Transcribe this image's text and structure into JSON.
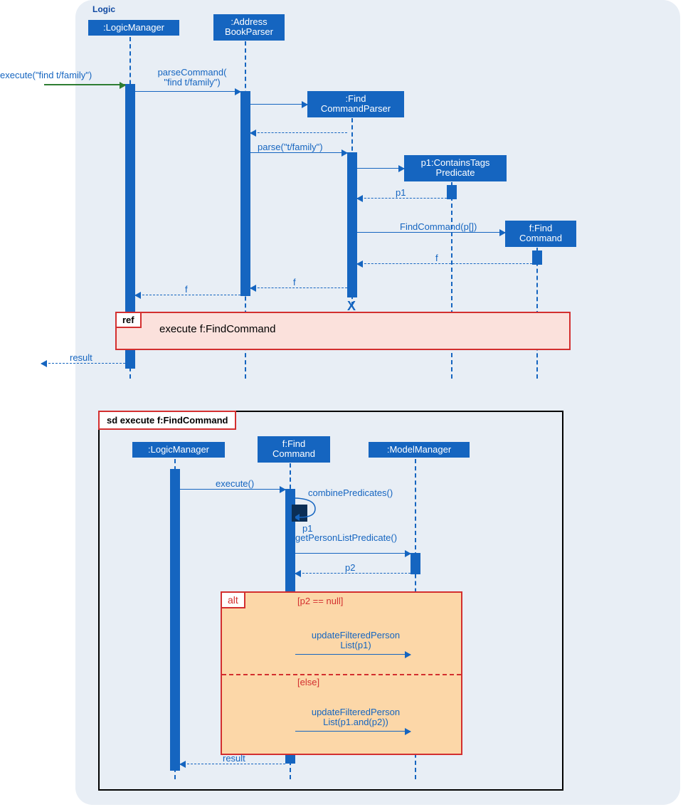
{
  "pkg": "Logic",
  "top": {
    "logicManager": ":LogicManager",
    "addressBookParser": ":Address BookParser",
    "findCommandParser": ":Find CommandParser",
    "containsTagsPredicate": "p1:ContainsTags Predicate",
    "findCommand": "f:Find Command"
  },
  "msgs": {
    "execute": "execute(\"find t/family\")",
    "parseCommand": "parseCommand( \"find t/family\")",
    "parse": "parse(\"t/family\")",
    "p1": "p1",
    "findCommandNew": "FindCommand(p[])",
    "f": "f",
    "result": "result"
  },
  "ref": {
    "tag": "ref",
    "title": "execute f:FindCommand"
  },
  "sd": {
    "title": "sd execute f:FindCommand",
    "logicManager": ":LogicManager",
    "findCommand": "f:Find Command",
    "modelManager": ":ModelManager",
    "execute": "execute()",
    "combinePredicates": "combinePredicates()",
    "p1": "p1",
    "getPersonListPredicate": "getPersonListPredicate()",
    "p2": "p2",
    "alt": "alt",
    "cond1": "[p2 == null]",
    "call1": "updateFilteredPerson List(p1)",
    "cond2": "[else]",
    "call2": "updateFilteredPerson List(p1.and(p2))",
    "result": "result"
  }
}
